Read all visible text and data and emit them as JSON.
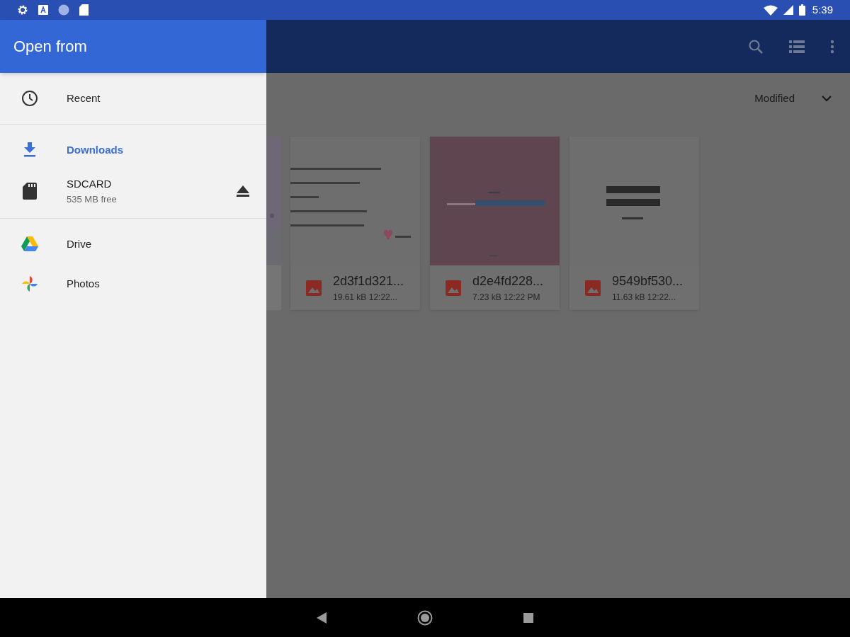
{
  "status_bar": {
    "time": "5:39"
  },
  "drawer": {
    "title": "Open from",
    "sections": [
      [
        {
          "label": "Recent",
          "kind": "clock",
          "selected": false
        }
      ],
      [
        {
          "label": "Downloads",
          "kind": "download",
          "selected": true
        },
        {
          "label": "SDCARD",
          "subtitle": "535 MB free",
          "kind": "sdcard",
          "selected": false,
          "eject": true
        }
      ],
      [
        {
          "label": "Drive",
          "kind": "drive",
          "selected": false
        },
        {
          "label": "Photos",
          "kind": "photos",
          "selected": false
        }
      ]
    ]
  },
  "sort": {
    "label": "Modified"
  },
  "files": [
    {
      "name": "2d3f1d321...",
      "meta": "19.61 kB 12:22...",
      "kind": "lines"
    },
    {
      "name": "d2e4fd228...",
      "meta": "7.23 kB 12:22 PM",
      "kind": "pink"
    },
    {
      "name": "9549bf530...",
      "meta": "11.63 kB 12:22...",
      "kind": "blocks"
    }
  ]
}
